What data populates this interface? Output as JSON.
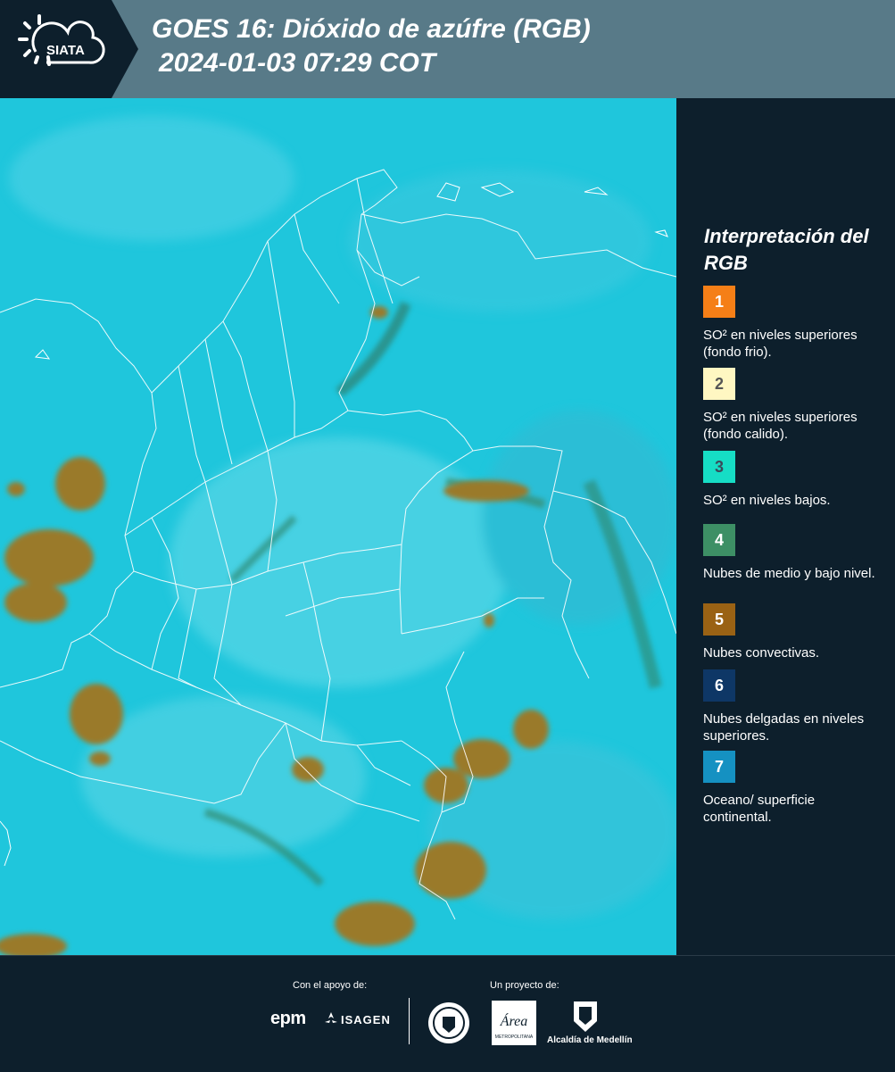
{
  "header": {
    "logo_text": "SIATA",
    "title_line1": "GOES 16: Dióxido de azúfre (RGB)",
    "title_line2": "2024-01-03 07:29 COT"
  },
  "legend": {
    "title": "Interpretación del RGB",
    "items": [
      {
        "number": "1",
        "color": "#f57f17",
        "text_color": "#ffffff",
        "label": "SO² en niveles superiores (fondo frio)."
      },
      {
        "number": "2",
        "color": "#fff7c2",
        "text_color": "#555555",
        "label": "SO² en niveles superiores (fondo calido)."
      },
      {
        "number": "3",
        "color": "#16ddc5",
        "text_color": "#3a4a5a",
        "label": "SO² en niveles bajos."
      },
      {
        "number": "4",
        "color": "#3d8f65",
        "text_color": "#ffffff",
        "label": "Nubes de medio y bajo nivel."
      },
      {
        "number": "5",
        "color": "#9a6214",
        "text_color": "#ffffff",
        "label": "Nubes convectivas."
      },
      {
        "number": "6",
        "color": "#0e3766",
        "text_color": "#ffffff",
        "label": "Nubes delgadas en niveles superiores."
      },
      {
        "number": "7",
        "color": "#1591c2",
        "text_color": "#ffffff",
        "label": "Oceano/ superficie continental."
      }
    ]
  },
  "map": {
    "background_color": "#1fc6dc",
    "cloud_color": "#9a7a2a",
    "border_color": "#ffffff"
  },
  "footer": {
    "support_label": "Con el apoyo de:",
    "project_label": "Un proyecto de:",
    "sponsors": [
      "epm",
      "ISAGEN"
    ],
    "partners": [
      "METROPOLITANA Valle de Aburrá",
      "Alcaldía de Medellín"
    ],
    "area_logo_text": "Área",
    "area_logo_sub": "METROPOLITANA",
    "alcaldia_text": "Alcaldía de Medellín"
  }
}
